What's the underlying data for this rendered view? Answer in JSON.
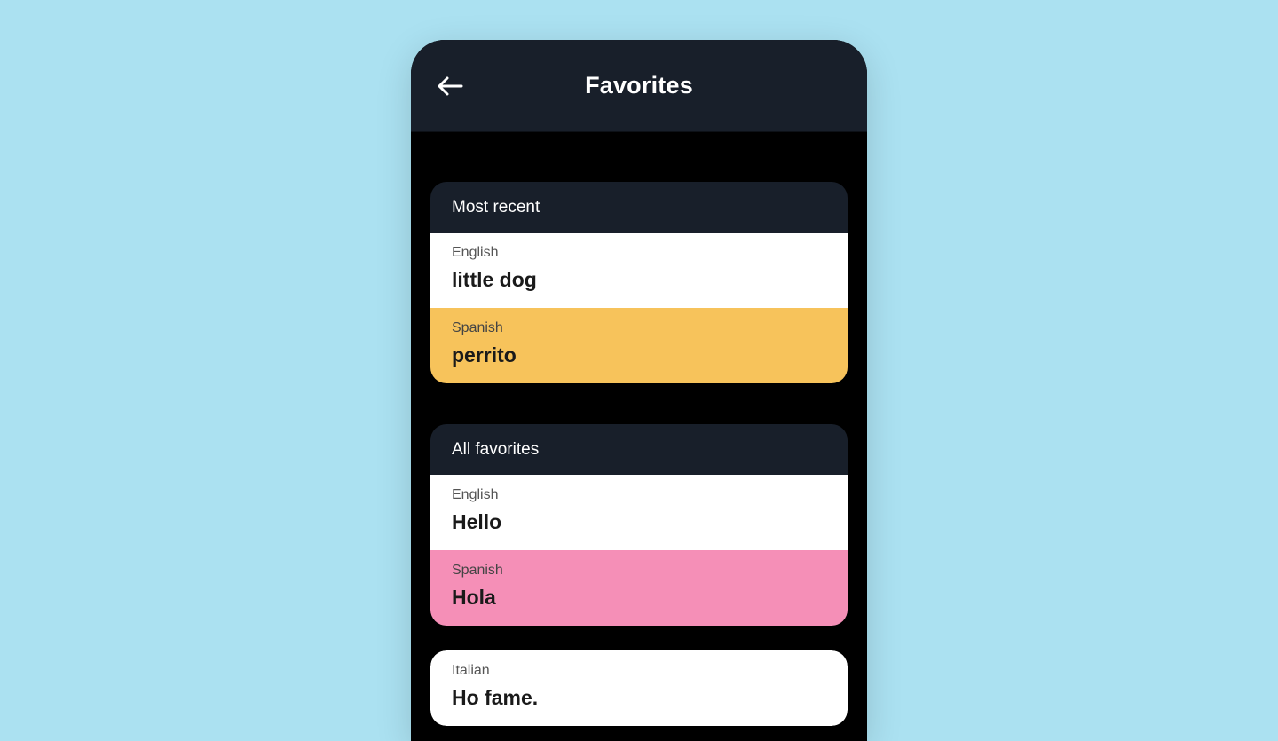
{
  "header": {
    "title": "Favorites"
  },
  "sections": {
    "recent": {
      "heading": "Most recent",
      "source": {
        "lang": "English",
        "text": "little dog"
      },
      "target": {
        "lang": "Spanish",
        "text": "perrito",
        "color": "orange"
      }
    },
    "all": {
      "heading": "All favorites",
      "items": [
        {
          "source": {
            "lang": "English",
            "text": "Hello"
          },
          "target": {
            "lang": "Spanish",
            "text": "Hola",
            "color": "pink"
          }
        },
        {
          "source": {
            "lang": "Italian",
            "text": "Ho fame."
          }
        }
      ]
    }
  },
  "colors": {
    "background": "#abe1f1",
    "device_bg": "#000000",
    "header_bg": "#181f2a",
    "orange": "#f7c35b",
    "pink": "#f58fb7"
  }
}
